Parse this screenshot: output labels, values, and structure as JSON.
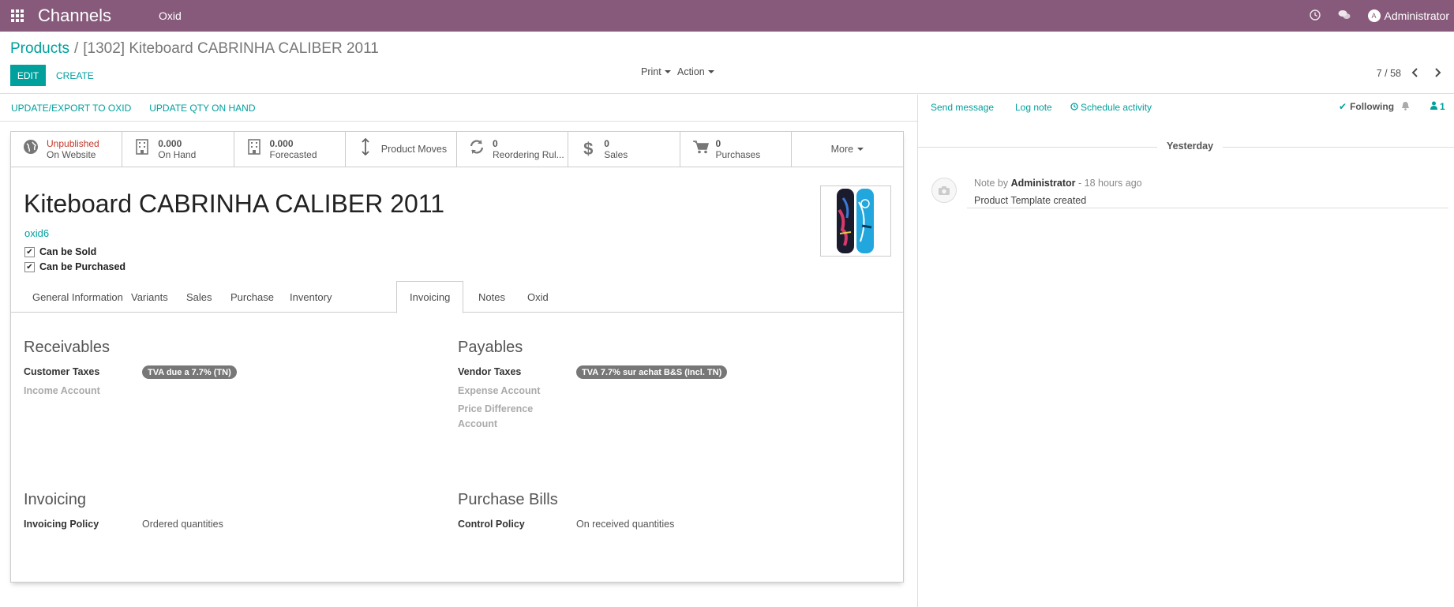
{
  "navbar": {
    "app_name": "Channels",
    "menu_item": "Oxid",
    "user_initials": "A",
    "user_name": "Administrator",
    "brand_color": "#875a7b"
  },
  "control_panel": {
    "breadcrumb_parent": "Products",
    "breadcrumb_separator": "/",
    "breadcrumb_current": "[1302] Kiteboard CABRINHA CALIBER 2011",
    "edit_label": "EDIT",
    "create_label": "CREATE",
    "print_label": "Print",
    "action_label": "Action",
    "pager": "7 / 58"
  },
  "header_buttons": {
    "update_export": "UPDATE/EXPORT TO OXID",
    "update_qty": "UPDATE QTY ON HAND"
  },
  "smart_buttons": [
    {
      "top": "Unpublished",
      "bottom": "On Website",
      "icon": "globe-icon"
    },
    {
      "top": "0.000",
      "bottom": "On Hand",
      "icon": "building-icon"
    },
    {
      "top": "0.000",
      "bottom": "Forecasted",
      "icon": "building-icon"
    },
    {
      "label": "Product Moves",
      "icon": "arrows-vertical-icon"
    },
    {
      "top": "0",
      "bottom": "Reordering Rul...",
      "icon": "refresh-icon"
    },
    {
      "top": "0",
      "bottom": "Sales",
      "icon": "dollar-icon"
    },
    {
      "top": "0",
      "bottom": "Purchases",
      "icon": "cart-icon"
    },
    {
      "label": "More"
    }
  ],
  "product": {
    "name": "Kiteboard CABRINHA CALIBER 2011",
    "reference": "oxid6",
    "can_be_sold": "Can be Sold",
    "can_be_purchased": "Can be Purchased"
  },
  "tabs": [
    "General Information",
    "Variants",
    "Sales",
    "Purchase",
    "Inventory",
    "Invoicing",
    "Notes",
    "Oxid"
  ],
  "active_tab": "Invoicing",
  "invoicing_tab": {
    "receivables": {
      "title": "Receivables",
      "customer_taxes_label": "Customer Taxes",
      "customer_taxes_tag": "TVA due a 7.7% (TN)",
      "income_account_label": "Income Account"
    },
    "payables": {
      "title": "Payables",
      "vendor_taxes_label": "Vendor Taxes",
      "vendor_taxes_tag": "TVA 7.7% sur achat B&S (Incl. TN)",
      "expense_account_label": "Expense Account",
      "price_diff_label_1": "Price Difference",
      "price_diff_label_2": "Account"
    },
    "invoicing": {
      "title": "Invoicing",
      "policy_label": "Invoicing Policy",
      "policy_value": "Ordered quantities"
    },
    "purchase_bills": {
      "title": "Purchase Bills",
      "control_label": "Control Policy",
      "control_value": "On received quantities"
    }
  },
  "chatter": {
    "send_message": "Send message",
    "log_note": "Log note",
    "schedule_activity": "Schedule activity",
    "following": "Following",
    "followers_count": "1",
    "date_separator": "Yesterday",
    "message": {
      "prefix": "Note by",
      "author": "Administrator",
      "time": "- 18 hours ago",
      "body": "Product Template created"
    }
  }
}
